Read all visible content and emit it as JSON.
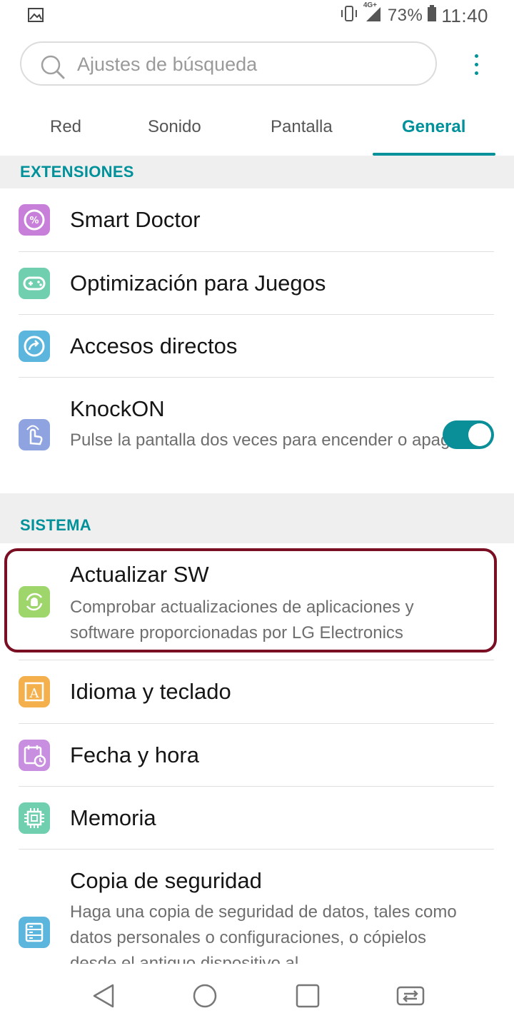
{
  "status_bar": {
    "network_label": "4G+",
    "battery_percent": "73%",
    "time": "11:40"
  },
  "search": {
    "placeholder": "Ajustes de búsqueda"
  },
  "tabs": [
    {
      "label": "Red"
    },
    {
      "label": "Sonido"
    },
    {
      "label": "Pantalla"
    },
    {
      "label": "General",
      "active": true
    }
  ],
  "sections": [
    {
      "header": "EXTENSIONES",
      "items": [
        {
          "title": "Smart Doctor",
          "icon": "smart-doctor-icon",
          "icon_color": "#c77fd9"
        },
        {
          "title": "Optimización para Juegos",
          "icon": "gamepad-icon",
          "icon_color": "#6fcfae"
        },
        {
          "title": "Accesos directos",
          "icon": "shortcut-arrow-icon",
          "icon_color": "#5bb5dd"
        },
        {
          "title": "KnockON",
          "subtitle": "Pulse la pantalla dos veces para encender o apagar",
          "icon": "knock-hand-icon",
          "icon_color": "#8ea3e0",
          "toggle_on": true
        }
      ]
    },
    {
      "header": "SISTEMA",
      "items": [
        {
          "title": "Actualizar SW",
          "subtitle": "Comprobar actualizaciones de aplicaciones y software proporcionadas por LG Electronics",
          "icon": "android-update-icon",
          "icon_color": "#9fd66b",
          "highlighted": true
        },
        {
          "title": "Idioma y teclado",
          "icon": "language-a-icon",
          "icon_color": "#f5b04e"
        },
        {
          "title": "Fecha y hora",
          "icon": "calendar-clock-icon",
          "icon_color": "#c88ee0"
        },
        {
          "title": "Memoria",
          "icon": "chip-icon",
          "icon_color": "#6fcfae"
        },
        {
          "title": "Copia de seguridad",
          "subtitle": "Haga una copia de seguridad de datos, tales como datos personales o configuraciones, o cópielos desde el antiguo dispositivo al",
          "icon": "backup-list-icon",
          "icon_color": "#5bb5dd"
        }
      ]
    }
  ],
  "colors": {
    "accent": "#00919a",
    "highlight_border": "#7a0f24"
  }
}
